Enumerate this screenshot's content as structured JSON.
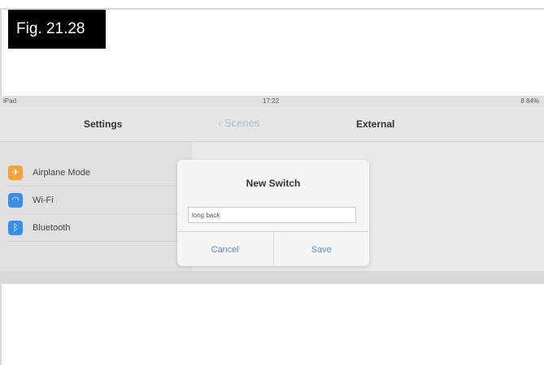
{
  "figure": {
    "label": "Fig. 21.28"
  },
  "status_bar": {
    "left": "iPad",
    "time": "17:22",
    "right": "8 84%"
  },
  "nav": {
    "settings_title": "Settings",
    "back_label": "Scenes",
    "title": "External"
  },
  "settings": {
    "items": [
      {
        "label": "Airplane Mode",
        "icon": "airplane-icon",
        "color": "#f2a33a"
      },
      {
        "label": "Wi-Fi",
        "icon": "wifi-icon",
        "color": "#3a8ee6"
      },
      {
        "label": "Bluetooth",
        "icon": "bluetooth-icon",
        "color": "#3a8ee6"
      }
    ]
  },
  "dialog": {
    "title": "New Switch",
    "input_value": "long back",
    "cancel_label": "Cancel",
    "save_label": "Save"
  }
}
